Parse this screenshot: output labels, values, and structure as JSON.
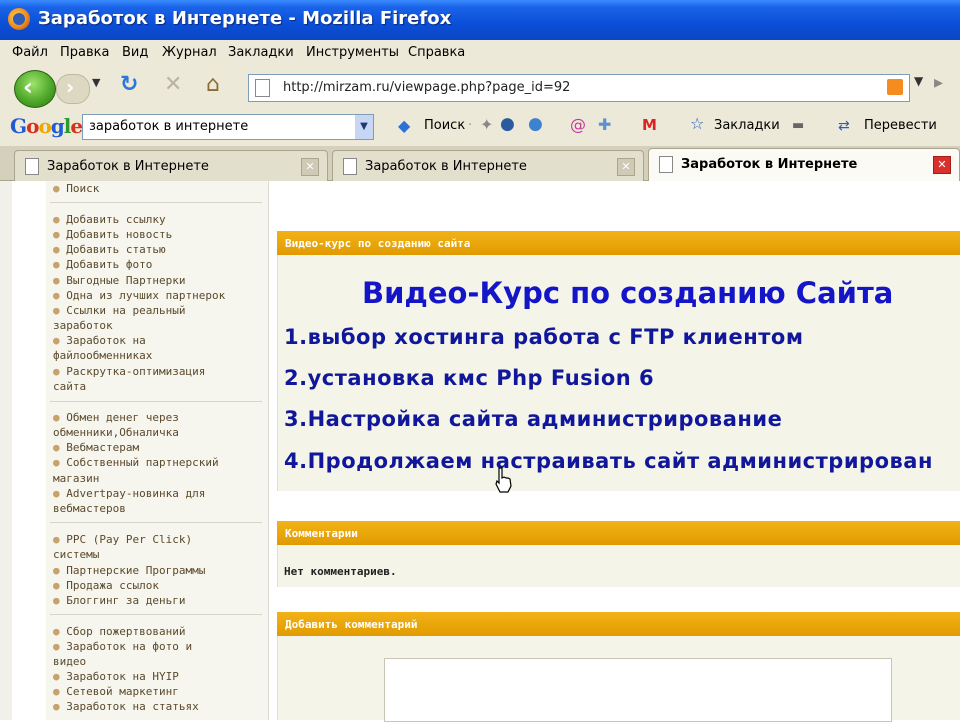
{
  "window": {
    "title": "Заработок в Интернете - Mozilla Firefox"
  },
  "menu": [
    "Файл",
    "Правка",
    "Вид",
    "Журнал",
    "Закладки",
    "Инструменты",
    "Справка"
  ],
  "nav": {
    "url": "http://mirzam.ru/viewpage.php?page_id=92"
  },
  "googlebar": {
    "logo": "Google",
    "query": "заработок в интернете",
    "search_label": "Поиск",
    "bookmarks_label": "Закладки",
    "translate_label": "Перевести"
  },
  "tabs": [
    {
      "label": "Заработок в Интернете"
    },
    {
      "label": "Заработок в Интернете"
    },
    {
      "label": "Заработок в Интернете"
    }
  ],
  "sidebar": {
    "items": [
      "Поиск",
      "Добавить ссылку",
      "Добавить новость",
      "Добавить статью",
      "Добавить фото",
      "Выгодные Партнерки",
      "Одна из лучших партнерок",
      "Ссылки на реальный",
      "заработок",
      "Заработок на",
      "файлообменниках",
      "Раскрутка-оптимизация",
      "сайта",
      "Обмен денег через",
      "обменники,Обналичка",
      "Вебмастерам",
      "Собственный партнерский",
      "магазин",
      "Advertpay-новинка для",
      "вебмастеров",
      "PPC (Pay Per Click)",
      "системы",
      "Партнерские Программы",
      "Продажа ссылок",
      "Блоггинг за деньги",
      "Сбор пожертвований",
      "Заработок на фото и",
      "видео",
      "Заработок на HYIP",
      "Сетевой маркетинг",
      "Заработок на статьях"
    ]
  },
  "content": {
    "video_panel_header": "Видео-курс по созданию сайта",
    "big_title": "Видео-Курс по созданию Сайта",
    "lessons": [
      "1.выбор хостинга работа с FTP клиентом",
      "2.установка кмс Php Fusion 6",
      "3.Настройка сайта администрирование",
      "4.Продолжаем настраивать сайт администрирован"
    ],
    "comments_header": "Комментарии",
    "no_comments": "Нет комментариев.",
    "add_comment_header": "Добавить комментарий"
  },
  "colors": {
    "accent_orange": "#e9a300",
    "title_blue": "#1515c8",
    "lesson_blue": "#10179a"
  }
}
